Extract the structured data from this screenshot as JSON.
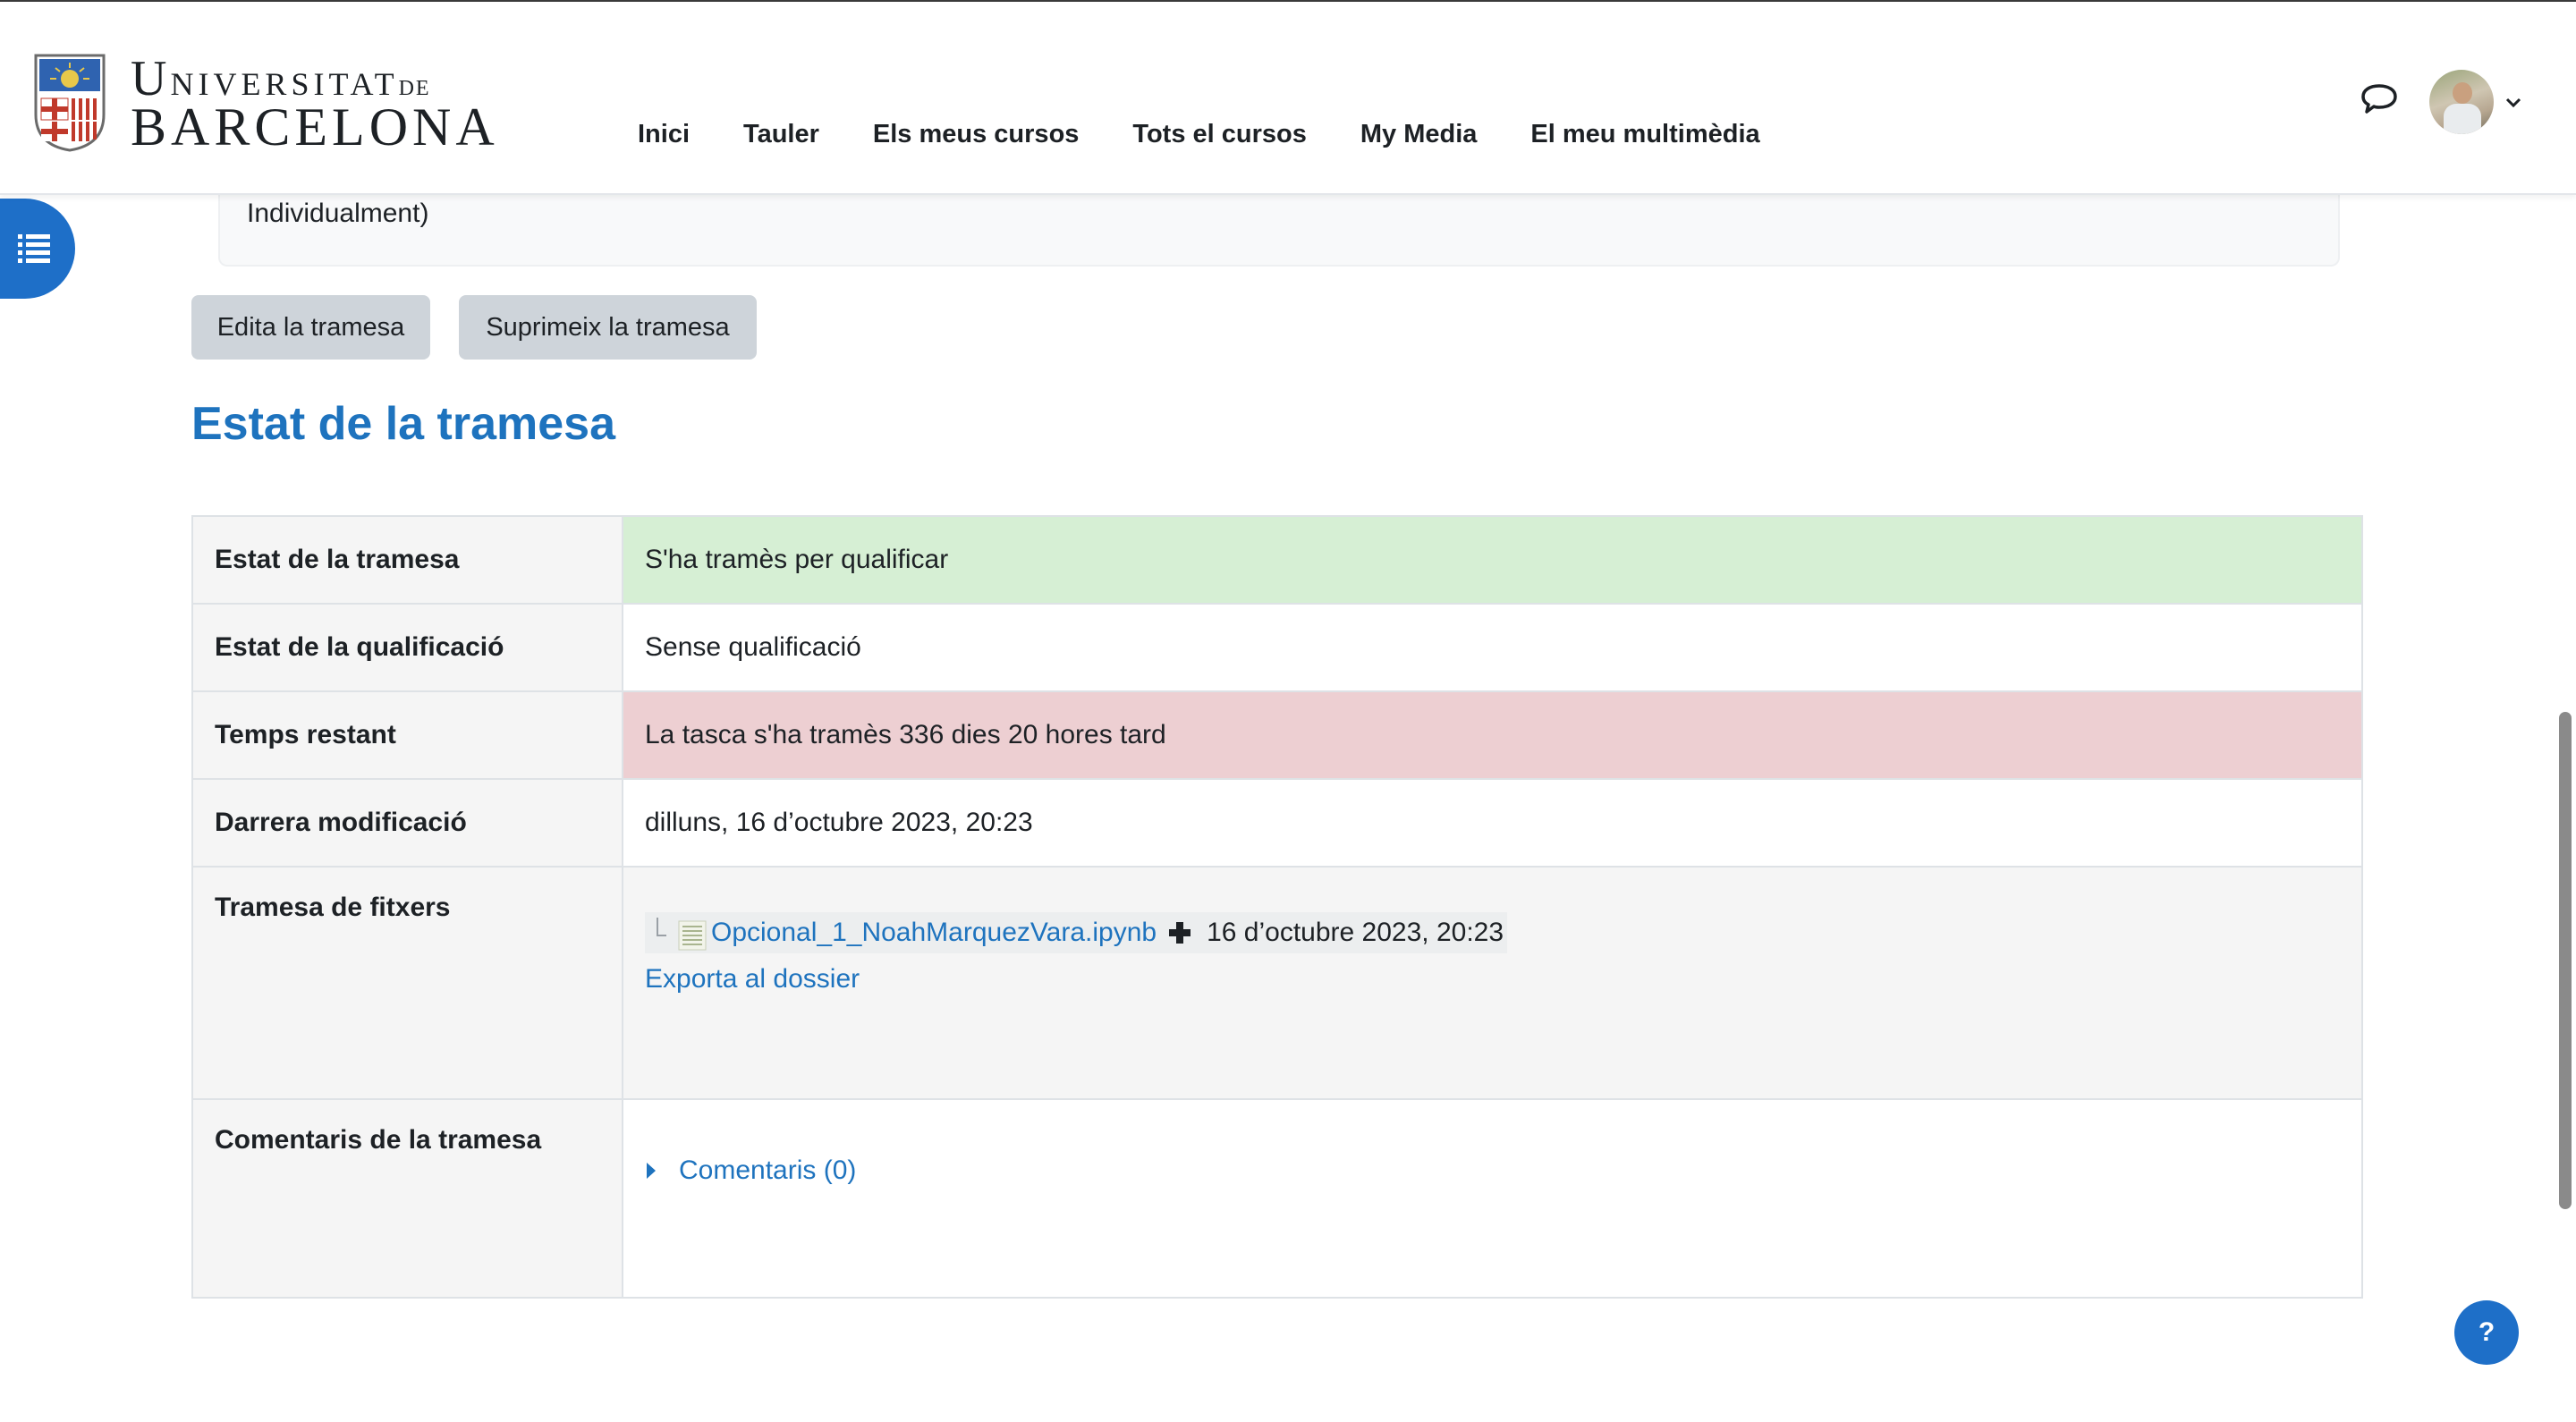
{
  "header": {
    "logo": {
      "line1_initial": "U",
      "line1_rest": "NIVERSITAT",
      "line1_suffix": "DE",
      "line2": "BARCELONA"
    },
    "nav_items": [
      {
        "label": "Inici"
      },
      {
        "label": "Tauler"
      },
      {
        "label": "Els meus cursos"
      },
      {
        "label": "Tots el cursos"
      },
      {
        "label": "My Media"
      },
      {
        "label": "El meu multimèdia"
      }
    ],
    "icons": {
      "messages": "speech-bubble-icon",
      "user_menu": "chevron-down-icon"
    }
  },
  "sidebar_toggle": {
    "icon": "list-icon"
  },
  "previous_section": {
    "trailing_text": "Individualment)"
  },
  "actions": {
    "edit_label": "Edita la tramesa",
    "delete_label": "Suprimeix la tramesa"
  },
  "submission_status": {
    "heading": "Estat de la tramesa",
    "rows": [
      {
        "label": "Estat de la tramesa",
        "value": "S'ha tramès per qualificar",
        "status_color": "#d6efd4"
      },
      {
        "label": "Estat de la qualificació",
        "value": "Sense qualificació"
      },
      {
        "label": "Temps restant",
        "value": "La tasca s'ha tramès 336 dies 20 hores tard",
        "status_color": "#edcfd2"
      },
      {
        "label": "Darrera modificació",
        "value": "dilluns, 16 d’octubre 2023, 20:23"
      },
      {
        "label": "Tramesa de fitxers",
        "file": {
          "name": "Opcional_1_NoahMarquezVara.ipynb",
          "date": "16 d’octubre 2023, 20:23",
          "icon": "document-icon",
          "action_icon": "plus-icon"
        },
        "export_label": "Exporta al dossier"
      },
      {
        "label": "Comentaris de la tramesa",
        "comments_label": "Comentaris (0)",
        "icon": "caret-right-icon"
      }
    ]
  },
  "help_button": {
    "label": "?"
  },
  "colors": {
    "accent": "#1e73be",
    "primary_button": "#1e6fc8",
    "secondary_button": "#ced4da"
  }
}
